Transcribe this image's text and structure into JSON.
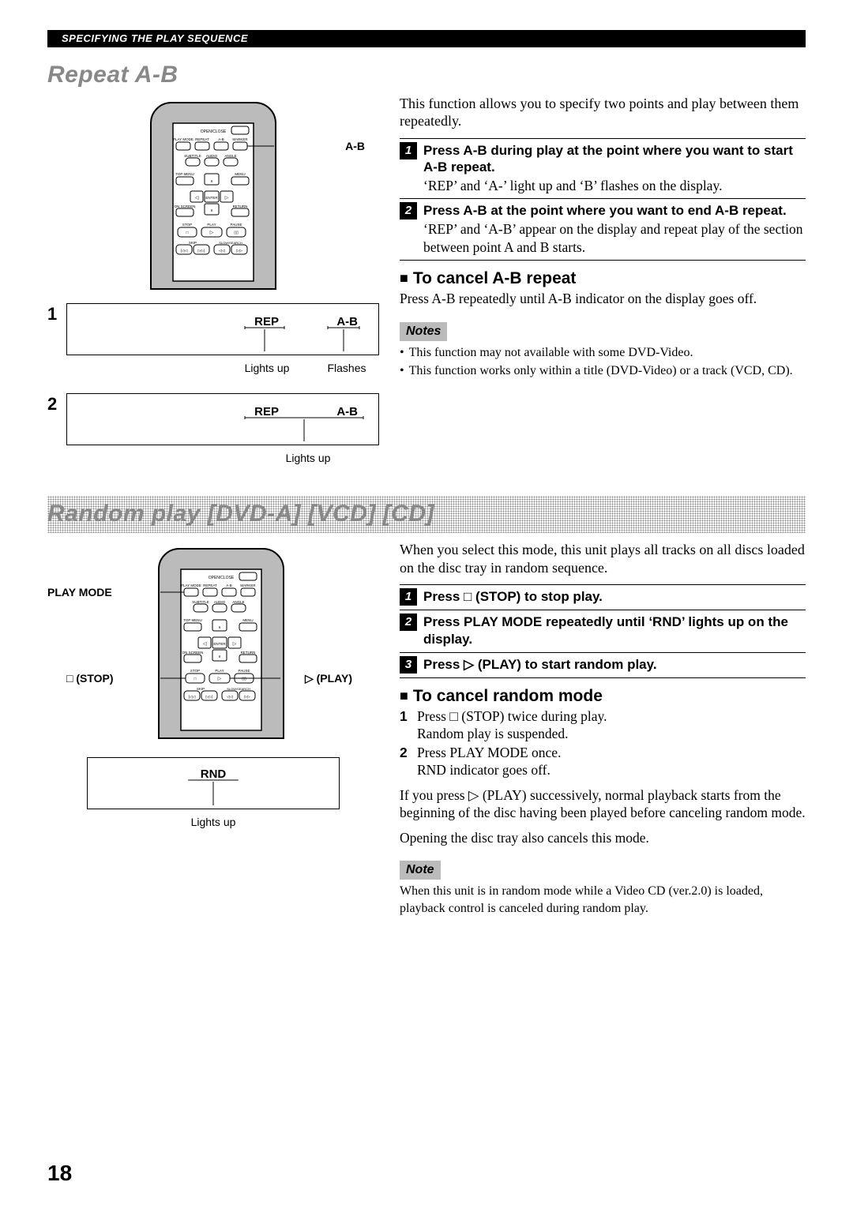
{
  "header": {
    "section": "SPECIFYING THE PLAY SEQUENCE"
  },
  "page_number": "18",
  "s1": {
    "title": "Repeat A-B",
    "callout_ab": "A-B",
    "disp1": {
      "num": "1",
      "rep": "REP",
      "ab": "A-B",
      "lights": "Lights up",
      "flashes": "Flashes"
    },
    "disp2": {
      "num": "2",
      "rep": "REP",
      "ab": "A-B",
      "lights": "Lights up"
    },
    "intro": "This function allows you to specify two points and play between them repeatedly.",
    "step1_b": "Press A-B during play at the point where you want to start A-B repeat.",
    "step1_p": "‘REP’ and ‘A-’ light up and ‘B’ flashes on the display.",
    "step2_b": "Press A-B at the point where you want to end A-B repeat.",
    "step2_p": "‘REP’ and ‘A-B’ appear on the display and repeat play of the section between point A and B starts.",
    "cancel_h": "To cancel A-B repeat",
    "cancel_p": "Press A-B repeatedly until A-B indicator on the display goes off.",
    "notes_label": "Notes",
    "note1": "This function may not available with some DVD-Video.",
    "note2": "This function works only within a title (DVD-Video) or a track (VCD, CD)."
  },
  "s2": {
    "title": "Random play [DVD-A] [VCD] [CD]",
    "callout_playmode": "PLAY MODE",
    "callout_stop": "□ (STOP)",
    "callout_play": "▷ (PLAY)",
    "disp": {
      "rnd": "RND",
      "lights": "Lights up"
    },
    "intro": "When you select this mode, this unit plays all tracks on all discs loaded on the disc tray in random sequence.",
    "step1_b": "Press □ (STOP) to stop play.",
    "step2_b": "Press PLAY MODE repeatedly until ‘RND’ lights up on the display.",
    "step3_b": "Press ▷ (PLAY) to start random play.",
    "cancel_h": "To cancel random mode",
    "cancel_1a": "Press □ (STOP) twice during play.",
    "cancel_1b": "Random play is suspended.",
    "cancel_2a": "Press PLAY MODE once.",
    "cancel_2b": "RND indicator goes off.",
    "after_p": "If you press ▷ (PLAY) successively, normal playback starts from the beginning of the disc having been played before canceling random mode.",
    "tray_p": "Opening the disc tray also cancels this mode.",
    "note_label": "Note",
    "note_p": "When this unit is in random mode while a Video CD (ver.2.0) is loaded, playback control is canceled during random play."
  }
}
